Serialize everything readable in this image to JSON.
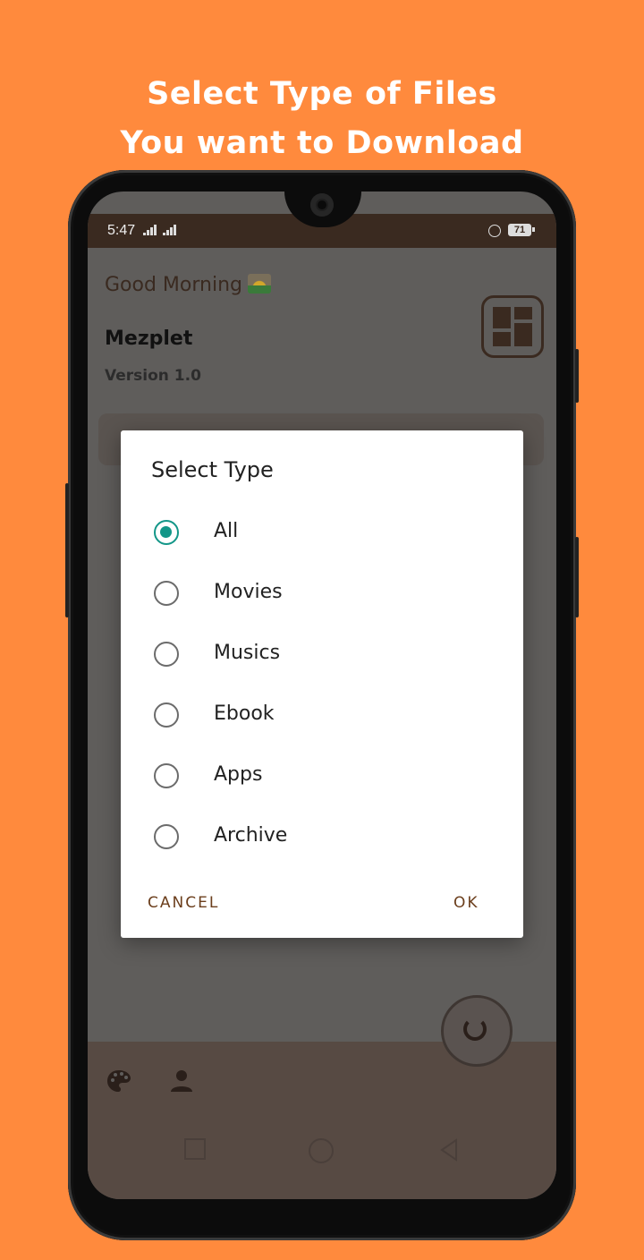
{
  "headline": {
    "line1": "Select Type of Files",
    "line2": "You want to Download"
  },
  "status_bar": {
    "time": "5:47",
    "battery": "71"
  },
  "app": {
    "greeting": "Good Morning",
    "name": "Mezplet",
    "version": "Version 1.0"
  },
  "dialog": {
    "title": "Select Type",
    "options": [
      {
        "label": "All",
        "selected": true
      },
      {
        "label": "Movies",
        "selected": false
      },
      {
        "label": "Musics",
        "selected": false
      },
      {
        "label": "Ebook",
        "selected": false
      },
      {
        "label": "Apps",
        "selected": false
      },
      {
        "label": "Archive",
        "selected": false
      }
    ],
    "cancel_label": "CANCEL",
    "ok_label": "OK"
  },
  "colors": {
    "background": "#FF8A3D",
    "accent_radio": "#139688",
    "button_text": "#6b3e1c"
  },
  "icons": [
    "grid-layout-icon",
    "refresh-icon",
    "palette-icon",
    "person-icon",
    "sunrise-icon"
  ]
}
